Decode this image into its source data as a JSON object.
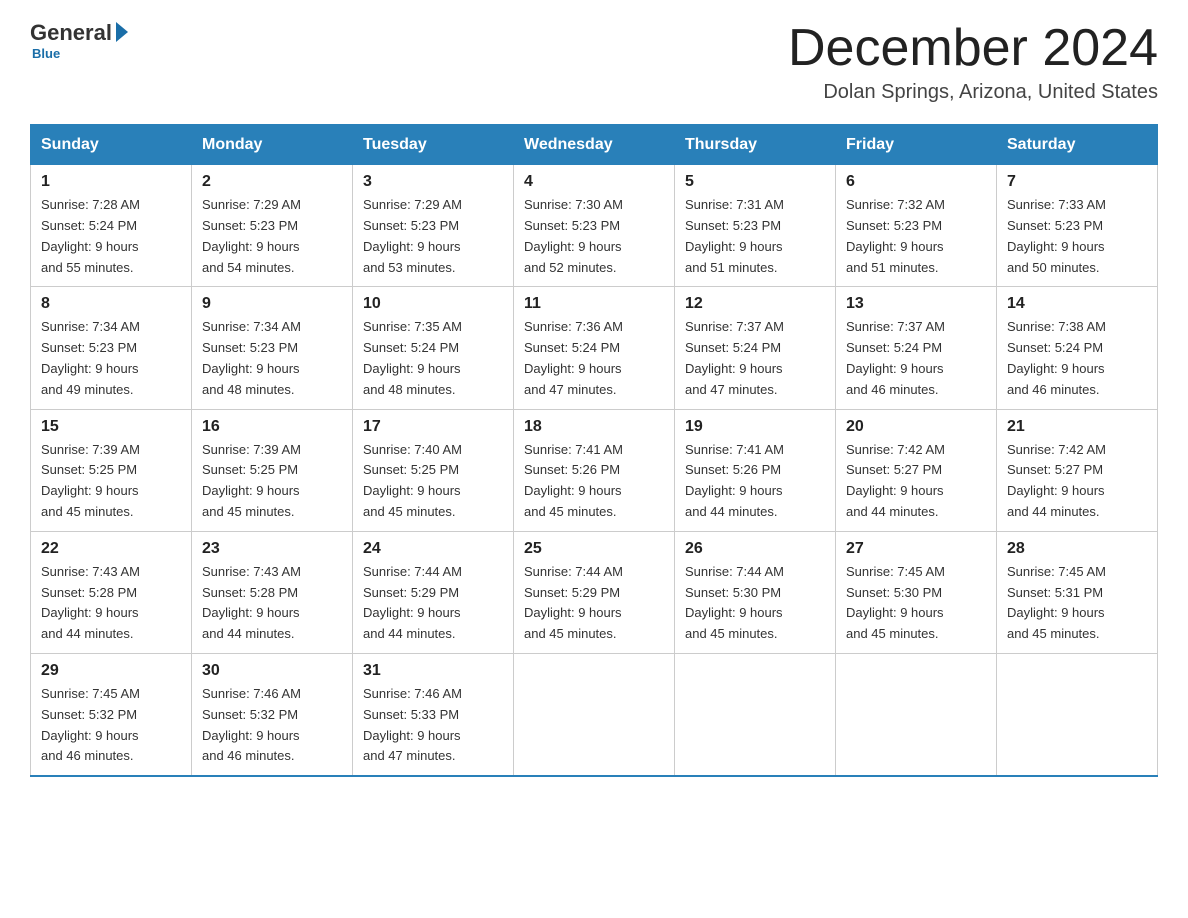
{
  "header": {
    "logo": {
      "general": "General",
      "blue": "Blue",
      "tagline": "Blue"
    },
    "title": "December 2024",
    "location": "Dolan Springs, Arizona, United States"
  },
  "weekdays": [
    "Sunday",
    "Monday",
    "Tuesday",
    "Wednesday",
    "Thursday",
    "Friday",
    "Saturday"
  ],
  "weeks": [
    [
      {
        "day": "1",
        "sunrise": "7:28 AM",
        "sunset": "5:24 PM",
        "daylight": "9 hours and 55 minutes."
      },
      {
        "day": "2",
        "sunrise": "7:29 AM",
        "sunset": "5:23 PM",
        "daylight": "9 hours and 54 minutes."
      },
      {
        "day": "3",
        "sunrise": "7:29 AM",
        "sunset": "5:23 PM",
        "daylight": "9 hours and 53 minutes."
      },
      {
        "day": "4",
        "sunrise": "7:30 AM",
        "sunset": "5:23 PM",
        "daylight": "9 hours and 52 minutes."
      },
      {
        "day": "5",
        "sunrise": "7:31 AM",
        "sunset": "5:23 PM",
        "daylight": "9 hours and 51 minutes."
      },
      {
        "day": "6",
        "sunrise": "7:32 AM",
        "sunset": "5:23 PM",
        "daylight": "9 hours and 51 minutes."
      },
      {
        "day": "7",
        "sunrise": "7:33 AM",
        "sunset": "5:23 PM",
        "daylight": "9 hours and 50 minutes."
      }
    ],
    [
      {
        "day": "8",
        "sunrise": "7:34 AM",
        "sunset": "5:23 PM",
        "daylight": "9 hours and 49 minutes."
      },
      {
        "day": "9",
        "sunrise": "7:34 AM",
        "sunset": "5:23 PM",
        "daylight": "9 hours and 48 minutes."
      },
      {
        "day": "10",
        "sunrise": "7:35 AM",
        "sunset": "5:24 PM",
        "daylight": "9 hours and 48 minutes."
      },
      {
        "day": "11",
        "sunrise": "7:36 AM",
        "sunset": "5:24 PM",
        "daylight": "9 hours and 47 minutes."
      },
      {
        "day": "12",
        "sunrise": "7:37 AM",
        "sunset": "5:24 PM",
        "daylight": "9 hours and 47 minutes."
      },
      {
        "day": "13",
        "sunrise": "7:37 AM",
        "sunset": "5:24 PM",
        "daylight": "9 hours and 46 minutes."
      },
      {
        "day": "14",
        "sunrise": "7:38 AM",
        "sunset": "5:24 PM",
        "daylight": "9 hours and 46 minutes."
      }
    ],
    [
      {
        "day": "15",
        "sunrise": "7:39 AM",
        "sunset": "5:25 PM",
        "daylight": "9 hours and 45 minutes."
      },
      {
        "day": "16",
        "sunrise": "7:39 AM",
        "sunset": "5:25 PM",
        "daylight": "9 hours and 45 minutes."
      },
      {
        "day": "17",
        "sunrise": "7:40 AM",
        "sunset": "5:25 PM",
        "daylight": "9 hours and 45 minutes."
      },
      {
        "day": "18",
        "sunrise": "7:41 AM",
        "sunset": "5:26 PM",
        "daylight": "9 hours and 45 minutes."
      },
      {
        "day": "19",
        "sunrise": "7:41 AM",
        "sunset": "5:26 PM",
        "daylight": "9 hours and 44 minutes."
      },
      {
        "day": "20",
        "sunrise": "7:42 AM",
        "sunset": "5:27 PM",
        "daylight": "9 hours and 44 minutes."
      },
      {
        "day": "21",
        "sunrise": "7:42 AM",
        "sunset": "5:27 PM",
        "daylight": "9 hours and 44 minutes."
      }
    ],
    [
      {
        "day": "22",
        "sunrise": "7:43 AM",
        "sunset": "5:28 PM",
        "daylight": "9 hours and 44 minutes."
      },
      {
        "day": "23",
        "sunrise": "7:43 AM",
        "sunset": "5:28 PM",
        "daylight": "9 hours and 44 minutes."
      },
      {
        "day": "24",
        "sunrise": "7:44 AM",
        "sunset": "5:29 PM",
        "daylight": "9 hours and 44 minutes."
      },
      {
        "day": "25",
        "sunrise": "7:44 AM",
        "sunset": "5:29 PM",
        "daylight": "9 hours and 45 minutes."
      },
      {
        "day": "26",
        "sunrise": "7:44 AM",
        "sunset": "5:30 PM",
        "daylight": "9 hours and 45 minutes."
      },
      {
        "day": "27",
        "sunrise": "7:45 AM",
        "sunset": "5:30 PM",
        "daylight": "9 hours and 45 minutes."
      },
      {
        "day": "28",
        "sunrise": "7:45 AM",
        "sunset": "5:31 PM",
        "daylight": "9 hours and 45 minutes."
      }
    ],
    [
      {
        "day": "29",
        "sunrise": "7:45 AM",
        "sunset": "5:32 PM",
        "daylight": "9 hours and 46 minutes."
      },
      {
        "day": "30",
        "sunrise": "7:46 AM",
        "sunset": "5:32 PM",
        "daylight": "9 hours and 46 minutes."
      },
      {
        "day": "31",
        "sunrise": "7:46 AM",
        "sunset": "5:33 PM",
        "daylight": "9 hours and 47 minutes."
      },
      null,
      null,
      null,
      null
    ]
  ]
}
